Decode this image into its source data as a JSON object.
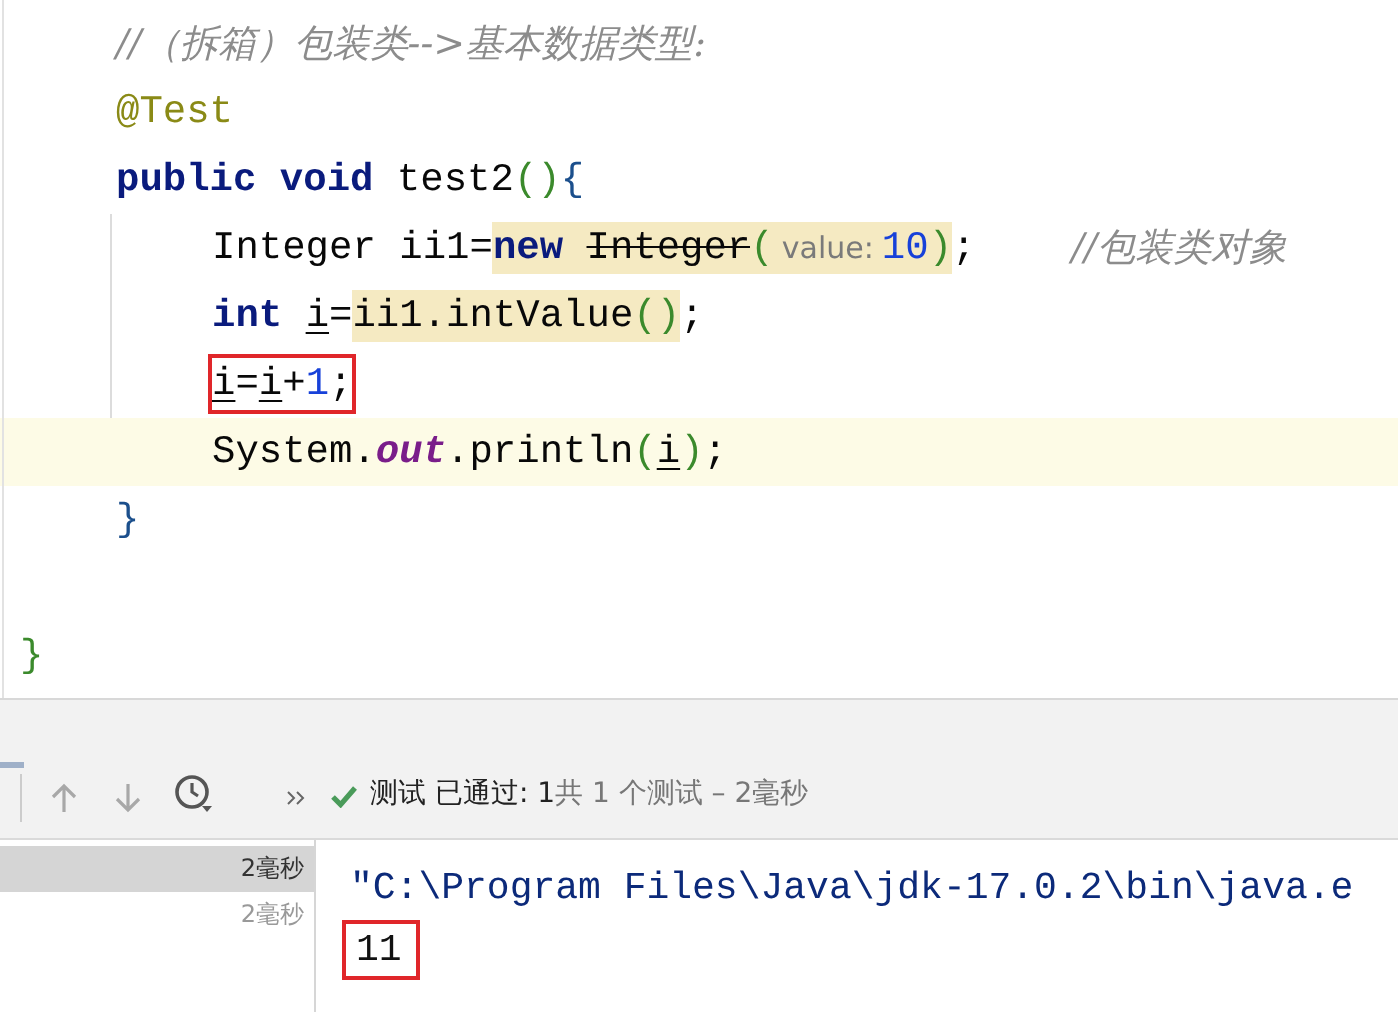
{
  "editor": {
    "lines": [
      {
        "current": false,
        "boxed": false,
        "children": [
          {
            "current": false,
            "boxed": false,
            "parts": [
              {
                "kind": "comment",
                "text": "//（拆箱）包装类-->基本数据类型:"
              }
            ]
          },
          {
            "current": false,
            "boxed": false,
            "parts": [
              {
                "kind": "code",
                "tokens": [
                  {
                    "text": "@Test",
                    "kind": "ann",
                    "highlighted": false
                  }
                ]
              }
            ]
          },
          {
            "current": false,
            "boxed": false,
            "parts": [
              {
                "kind": "code",
                "tokens": [
                  {
                    "text": "public void",
                    "kind": "kw",
                    "highlighted": false
                  },
                  {
                    "text": " test2",
                    "kind": "p",
                    "highlighted": false
                  },
                  {
                    "text": "()",
                    "kind": "pg",
                    "highlighted": false
                  },
                  {
                    "text": "{",
                    "kind": "br",
                    "highlighted": false
                  }
                ]
              }
            ],
            "children": [
              {
                "current": false,
                "boxed": false,
                "parts": [
                  {
                    "kind": "code",
                    "tokens": [
                      {
                        "text": "Integer ii1=",
                        "kind": "p",
                        "highlighted": false
                      },
                      {
                        "text": "new ",
                        "kind": "kw",
                        "highlighted": true
                      },
                      {
                        "text": "Integer",
                        "kind": "dep",
                        "highlighted": true
                      },
                      {
                        "text": "(",
                        "kind": "pg",
                        "highlighted": true
                      }
                    ]
                  },
                  {
                    "kind": "hint",
                    "text": "value:",
                    "highlighted": true
                  },
                  {
                    "kind": "code",
                    "tokens": [
                      {
                        "text": "10",
                        "kind": "num",
                        "highlighted": true
                      },
                      {
                        "text": ")",
                        "kind": "pg",
                        "highlighted": true
                      },
                      {
                        "text": ";",
                        "kind": "p",
                        "highlighted": false
                      }
                    ]
                  },
                  {
                    "kind": "trailing-comment",
                    "text": "//包装类对象"
                  }
                ]
              },
              {
                "current": false,
                "boxed": false,
                "parts": [
                  {
                    "kind": "code",
                    "tokens": [
                      {
                        "text": "int ",
                        "kind": "kw",
                        "highlighted": false
                      },
                      {
                        "text": "i",
                        "kind": "var",
                        "highlighted": false
                      },
                      {
                        "text": "=",
                        "kind": "p",
                        "highlighted": false
                      },
                      {
                        "text": "ii1.intValue",
                        "kind": "p",
                        "highlighted": true
                      },
                      {
                        "text": "()",
                        "kind": "pg",
                        "highlighted": true
                      },
                      {
                        "text": ";",
                        "kind": "p",
                        "highlighted": false
                      }
                    ]
                  }
                ]
              },
              {
                "current": false,
                "boxed": true,
                "parts": [
                  {
                    "kind": "code",
                    "tokens": [
                      {
                        "text": "i",
                        "kind": "var",
                        "highlighted": false
                      },
                      {
                        "text": "=",
                        "kind": "p",
                        "highlighted": false
                      },
                      {
                        "text": "i",
                        "kind": "var",
                        "highlighted": false
                      },
                      {
                        "text": "+",
                        "kind": "p",
                        "highlighted": false
                      },
                      {
                        "text": "1",
                        "kind": "num",
                        "highlighted": false
                      },
                      {
                        "text": ";",
                        "kind": "p",
                        "highlighted": false
                      }
                    ]
                  }
                ]
              },
              {
                "current": true,
                "boxed": false,
                "parts": [
                  {
                    "kind": "code",
                    "tokens": [
                      {
                        "text": "System.",
                        "kind": "p",
                        "highlighted": false
                      },
                      {
                        "text": "out",
                        "kind": "field",
                        "highlighted": false
                      },
                      {
                        "text": ".println",
                        "kind": "p",
                        "highlighted": false
                      },
                      {
                        "text": "(",
                        "kind": "pg",
                        "highlighted": false
                      },
                      {
                        "text": "i",
                        "kind": "var",
                        "highlighted": false
                      },
                      {
                        "text": ")",
                        "kind": "pg",
                        "highlighted": false
                      },
                      {
                        "text": ";",
                        "kind": "p",
                        "highlighted": false
                      }
                    ]
                  }
                ]
              }
            ]
          },
          {
            "current": false,
            "boxed": false,
            "parts": [
              {
                "kind": "code",
                "tokens": [
                  {
                    "text": "}",
                    "kind": "br",
                    "highlighted": false
                  }
                ]
              }
            ]
          }
        ]
      },
      {
        "current": false,
        "boxed": false,
        "parts": [
          {
            "kind": "code",
            "tokens": [
              {
                "text": "}",
                "kind": "pg",
                "highlighted": false
              }
            ]
          }
        ]
      }
    ]
  },
  "run_panel": {
    "status": "测试 已通过: 1",
    "summary": "共 1 个测试 – 2毫秒",
    "tests": [
      {
        "time": "2毫秒",
        "selected": true
      },
      {
        "time": "2毫秒",
        "selected": false
      }
    ],
    "console": [
      {
        "text": "\"C:\\Program Files\\Java\\jdk-17.0.2\\bin\\java.e",
        "kind": "command",
        "boxed": false
      },
      {
        "text": "11",
        "kind": "output",
        "boxed": true
      }
    ]
  }
}
